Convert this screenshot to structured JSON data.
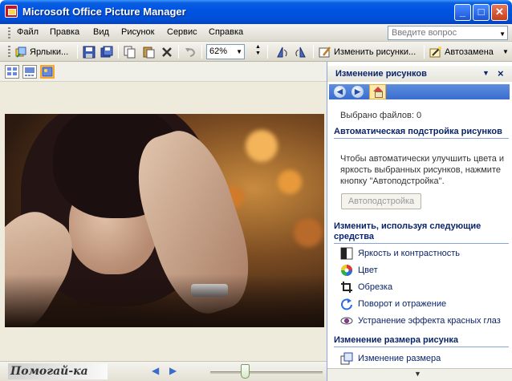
{
  "window": {
    "title": "Microsoft Office Picture Manager",
    "minimize_glyph": "_",
    "maximize_glyph": "□",
    "close_glyph": "✕"
  },
  "menu": {
    "items": [
      "Файл",
      "Правка",
      "Вид",
      "Рисунок",
      "Сервис",
      "Справка"
    ],
    "ask_placeholder": "Введите вопрос"
  },
  "toolbar": {
    "shortcuts_label": "Ярлыки...",
    "zoom_value": "62%",
    "edit_pictures_label": "Изменить рисунки...",
    "autocorrect_label": "Автозамена"
  },
  "viewer": {
    "watermark": "Помогай-ка",
    "zoom_slider_fraction": 0.31
  },
  "task_pane": {
    "title": "Изменение рисунков",
    "selected_files": "Выбрано файлов: 0",
    "auto_section_title": "Автоматическая подстройка рисунков",
    "auto_description": "Чтобы автоматически улучшить цвета и яркость выбранных рисунков, нажмите кнопку \"Автоподстройка\".",
    "auto_button": "Автоподстройка",
    "tools_section_title": "Изменить, используя следующие средства",
    "tools": [
      {
        "label": "Яркость и контрастность",
        "icon": "brightness-contrast-icon"
      },
      {
        "label": "Цвет",
        "icon": "color-wheel-icon"
      },
      {
        "label": "Обрезка",
        "icon": "crop-icon"
      },
      {
        "label": "Поворот и отражение",
        "icon": "rotate-flip-icon"
      },
      {
        "label": "Устранение эффекта красных глаз",
        "icon": "red-eye-icon"
      }
    ],
    "resize_section_title": "Изменение размера рисунка",
    "resize_link": "Изменение размера"
  },
  "colors": {
    "title_bar": "#0054e3",
    "pane_heading": "#0a246a",
    "active_view_border": "#ffa620"
  }
}
